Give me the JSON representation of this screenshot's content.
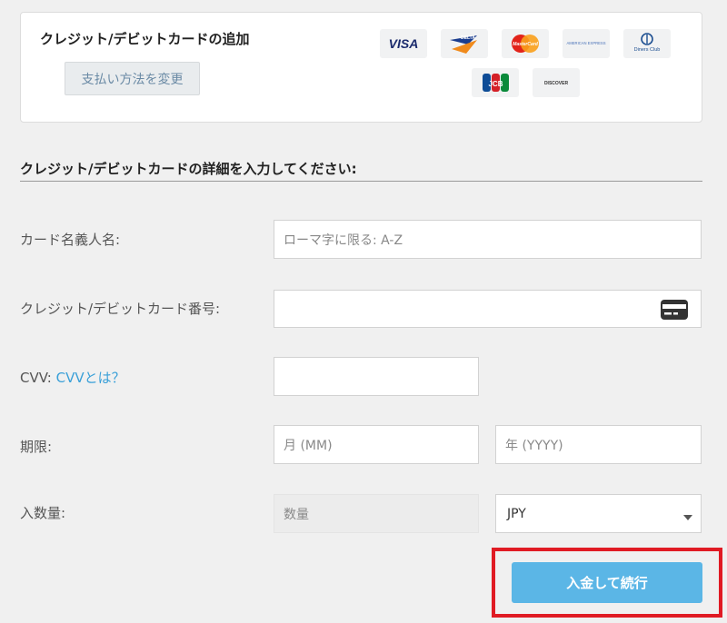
{
  "panel": {
    "title": "クレジット/デビットカードの追加",
    "change_button": "支払い方法を変更",
    "brand_logos": [
      {
        "name": "visa",
        "text": "VISA"
      },
      {
        "name": "delta",
        "text": "DELTA"
      },
      {
        "name": "mastercard",
        "text": "MasterCard"
      },
      {
        "name": "american-express",
        "text": "AMERICAN EXPRESS"
      },
      {
        "name": "diners-club",
        "text": "Diners Club"
      },
      {
        "name": "jcb",
        "text": "JCB"
      },
      {
        "name": "discover",
        "text": "DISCOVER"
      }
    ]
  },
  "form": {
    "section_title": "クレジット/デビットカードの詳細を入力してください:",
    "cardholder": {
      "label": "カード名義人名:",
      "placeholder": "ローマ字に限る: A-Z"
    },
    "card_number": {
      "label": "クレジット/デビットカード番号:",
      "placeholder": ""
    },
    "cvv": {
      "label": "CVV:",
      "help_link": "CVVとは？"
    },
    "expiry": {
      "label": "期限:",
      "month_placeholder": "月 (MM)",
      "year_placeholder": "年 (YYYY)"
    },
    "amount": {
      "label": "入数量:",
      "placeholder": "数量",
      "currency": "JPY"
    },
    "submit": "入金して続行"
  },
  "colors": {
    "accent": "#5bb6e6",
    "link": "#3aa0d8",
    "highlight_border": "#e01b24"
  },
  "icons": {
    "card_number_field": "credit-card-icon",
    "currency_dropdown": "caret-down-icon"
  }
}
